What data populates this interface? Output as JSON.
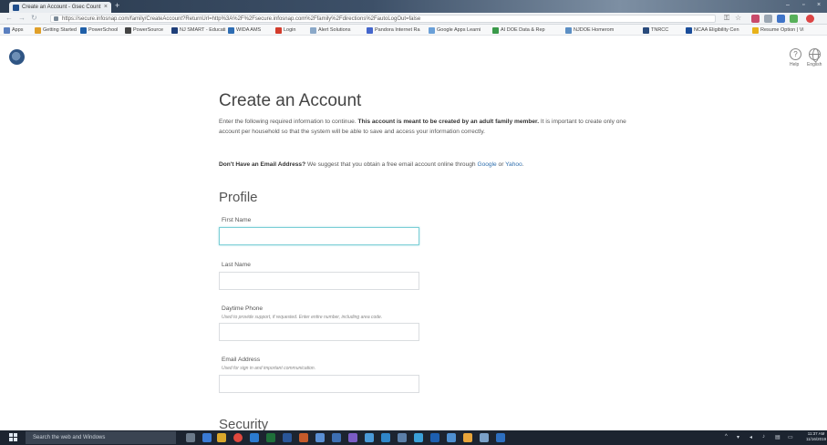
{
  "browser": {
    "tab_title": "Create an Account - Gsec Count",
    "url": "https://secure.infosnap.com/family/CreateAccount?ReturnUrl=http%3A%2F%2Fsecure.infosnap.com%2Ffamily%2Fdirections%2FautoLogOut=false",
    "bookmarks": [
      {
        "label": "Apps",
        "color": "#5a7fbf"
      },
      {
        "label": "Getting Started",
        "color": "#e0a02a"
      },
      {
        "label": "PowerSchool",
        "color": "#1f5fa8"
      },
      {
        "label": "PowerSource",
        "color": "#444444"
      },
      {
        "label": "NJ SMART - Educati",
        "color": "#1f3f7a"
      },
      {
        "label": "WIDA AMS",
        "color": "#2e6db3"
      },
      {
        "label": "Login",
        "color": "#d33c2c"
      },
      {
        "label": "Alert Solutions",
        "color": "#8aa8c8"
      },
      {
        "label": "Pandora Internet Ra",
        "color": "#4466cc"
      },
      {
        "label": "Google Apps Learni",
        "color": "#6aa0d8"
      },
      {
        "label": "AI DOE Data & Rep",
        "color": "#3a9a4a"
      },
      {
        "label": "NJDOE Homerom",
        "color": "#5c8fc4"
      },
      {
        "label": "TNRCC",
        "color": "#2a4b7c"
      },
      {
        "label": "NCAA Eligibility Cen",
        "color": "#1a4d9a"
      },
      {
        "label": "Resume Option | Vi",
        "color": "#e8b21a"
      }
    ]
  },
  "header": {
    "help_label": "Help",
    "language_label": "English"
  },
  "page": {
    "title": "Create an Account",
    "intro_pre": "Enter the following required information to continue. ",
    "intro_bold": "This account is meant to be created by an adult family member.",
    "intro_post": " It is important to create only one account per household so that the system will be able to save and access your information correctly.",
    "no_email_bold": "Don't Have an Email Address?",
    "no_email_text": " We suggest that you obtain a free email account online through ",
    "google_link": "Google",
    "or_text": " or ",
    "yahoo_link": "Yahoo",
    "period": "."
  },
  "profile": {
    "heading": "Profile",
    "first_name": {
      "label": "First Name",
      "value": ""
    },
    "last_name": {
      "label": "Last Name",
      "value": ""
    },
    "daytime_phone": {
      "label": "Daytime Phone",
      "hint": "Used to provide support, if requested. Enter entire number, including area code.",
      "value": ""
    },
    "email": {
      "label": "Email Address",
      "hint": "Used for sign in and important communication.",
      "value": ""
    }
  },
  "security": {
    "heading": "Security"
  },
  "taskbar": {
    "search_placeholder": "Search the web and Windows",
    "clock_time": "11:37 AM",
    "clock_date": "11/16/2019"
  }
}
